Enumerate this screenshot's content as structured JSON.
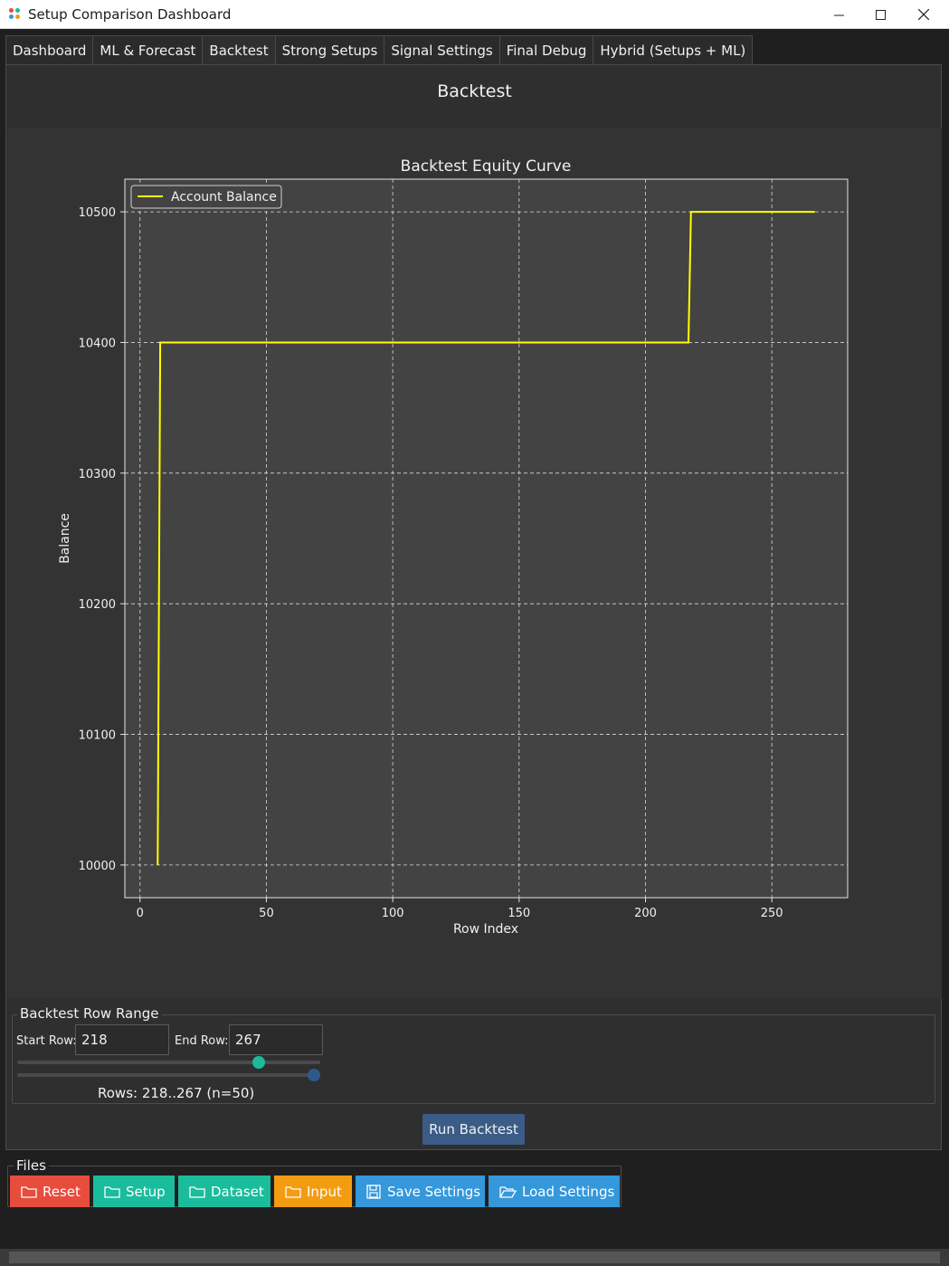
{
  "window": {
    "title": "Setup Comparison Dashboard",
    "minimize_label": "─",
    "maximize_label": "☐",
    "close_label": "✕"
  },
  "tabs": [
    {
      "label": "Dashboard"
    },
    {
      "label": "ML & Forecast"
    },
    {
      "label": "Backtest",
      "active": true
    },
    {
      "label": "Strong Setups"
    },
    {
      "label": "Signal Settings"
    },
    {
      "label": "Final Debug"
    },
    {
      "label": "Hybrid (Setups + ML)"
    }
  ],
  "backtest": {
    "heading": "Backtest",
    "range_group_title": "Backtest Row Range",
    "start_label": "Start Row:",
    "start_value": "218",
    "end_label": "End Row:",
    "end_value": "267",
    "start_slider_fraction": 0.81,
    "end_slider_fraction": 1.0,
    "rows_info": "Rows: 218..267 (n=50)",
    "run_label": "Run Backtest"
  },
  "files": {
    "group_title": "Files",
    "buttons": [
      {
        "label": "Reset",
        "color": "#e74c3c",
        "icon": "folder-icon"
      },
      {
        "label": "Setup",
        "color": "#1abc9c",
        "icon": "folder-icon"
      },
      {
        "label": "Dataset",
        "color": "#1abc9c",
        "icon": "folder-icon"
      },
      {
        "label": "Input",
        "color": "#f39c12",
        "icon": "folder-icon"
      },
      {
        "label": "Save Settings",
        "color": "#3498db",
        "icon": "save-icon"
      },
      {
        "label": "Load Settings",
        "color": "#3498db",
        "icon": "folder-open-icon"
      }
    ]
  },
  "chart_data": {
    "type": "line",
    "title": "Backtest Equity Curve",
    "xlabel": "Row Index",
    "ylabel": "Balance",
    "xlim": [
      -6,
      280
    ],
    "ylim": [
      9975,
      10525
    ],
    "xticks": [
      0,
      50,
      100,
      150,
      200,
      250
    ],
    "yticks": [
      10000,
      10100,
      10200,
      10300,
      10400,
      10500
    ],
    "grid": true,
    "legend_position": "top-left",
    "series": [
      {
        "name": "Account Balance",
        "color": "#ffff00",
        "x": [
          7,
          8,
          217,
          218,
          267
        ],
        "y": [
          10000,
          10400,
          10400,
          10500,
          10500
        ]
      }
    ]
  }
}
